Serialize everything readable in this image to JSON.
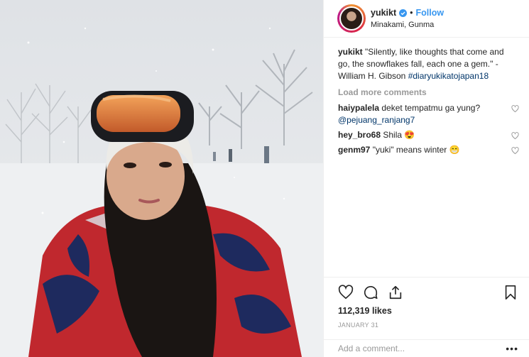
{
  "post": {
    "username": "yukikt",
    "follow_label": "Follow",
    "separator": "•",
    "location": "Minakami, Gunma",
    "caption": {
      "username": "yukikt",
      "text": "\"Silently, like thoughts that come and go, the snowflakes fall, each one a gem.\" - William H. Gibson",
      "hashtag": "#diaryukikatojapan18"
    },
    "load_more": "Load more comments",
    "comments": [
      {
        "user": "haiypalela",
        "text": "deket tempatmu ga yung?",
        "mention": "@pejuang_ranjang7"
      },
      {
        "user": "hey_bro68",
        "text": "Shila",
        "emoji": "😍"
      },
      {
        "user": "genm97",
        "text": "\"yuki\" means winter",
        "emoji": "😁"
      }
    ],
    "likes": "112,319 likes",
    "date": "JANUARY 31",
    "add_comment_placeholder": "Add a comment...",
    "more_label": "•••"
  },
  "colors": {
    "accent": "#3897f0",
    "jacket_red": "#c0282e",
    "jacket_blue": "#1e2a5e",
    "snow": "#e9ebee"
  }
}
